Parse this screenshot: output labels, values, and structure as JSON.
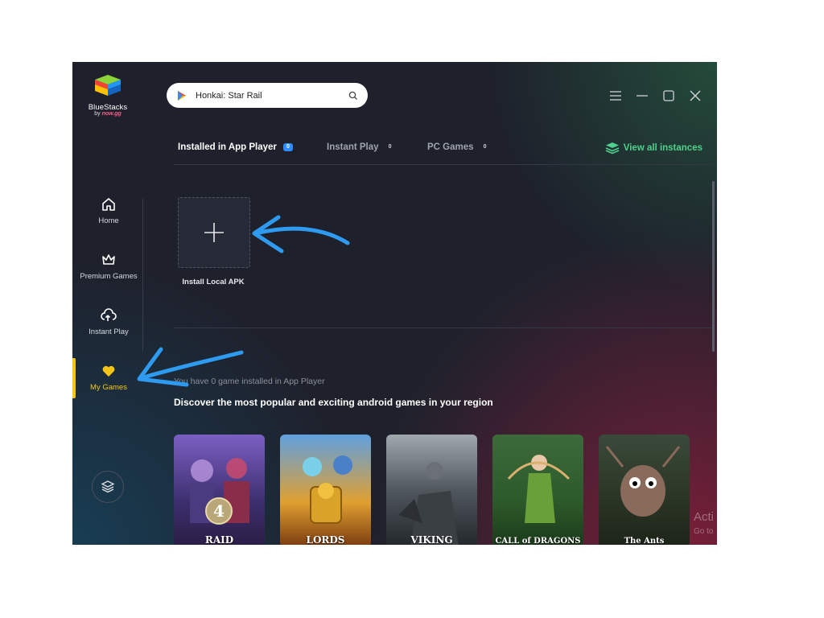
{
  "brand": {
    "name": "BlueStacks",
    "by": "by",
    "by_brand": "now.gg"
  },
  "sidebar": {
    "items": [
      {
        "label": "Home",
        "icon": "home-icon"
      },
      {
        "label": "Premium Games",
        "icon": "crown-icon"
      },
      {
        "label": "Instant Play",
        "icon": "cloud-play-icon"
      },
      {
        "label": "My Games",
        "icon": "heart-icon",
        "active": true
      }
    ],
    "bottom_icon": "layers-icon"
  },
  "search": {
    "value": "Honkai: Star Rail",
    "icon": "search-icon",
    "store_icon": "play-store-icon"
  },
  "window_controls": [
    "menu-icon",
    "minimize-icon",
    "maximize-icon",
    "close-icon"
  ],
  "tabs": [
    {
      "label": "Installed in App Player",
      "count": "0",
      "active": true
    },
    {
      "label": "Instant Play",
      "count": "0"
    },
    {
      "label": "PC Games",
      "count": "0"
    }
  ],
  "view_all": "View all instances",
  "install_local_apk": "Install Local APK",
  "status_text": "You have 0 game installed in App Player",
  "discover_heading": "Discover the most popular and exciting android games in your region",
  "games": [
    {
      "title": "RAID"
    },
    {
      "title": "LORDS"
    },
    {
      "title": "VIKING"
    },
    {
      "title": "CALL of DRAGONS"
    },
    {
      "title": "The Ants"
    }
  ],
  "watermark": {
    "line1": "Acti",
    "line2": "Go to"
  },
  "colors": {
    "accent_active": "#f5c518",
    "view_all": "#4fd08c",
    "annotation_arrow": "#2e9bf0",
    "badge_blue": "#2d8cff"
  }
}
